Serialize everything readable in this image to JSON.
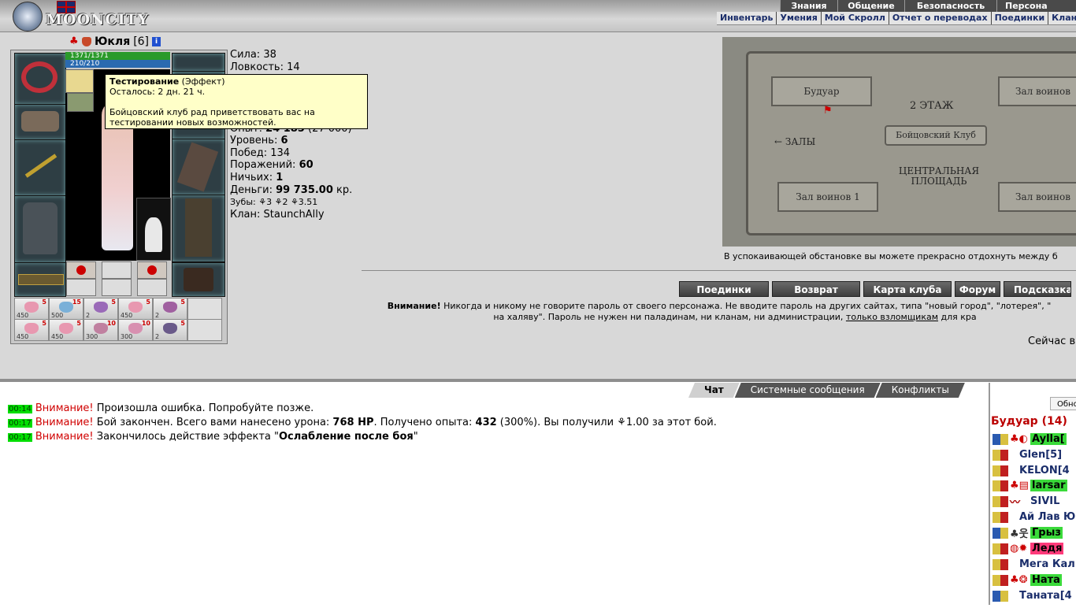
{
  "app": {
    "logo_text": "MOONCITY"
  },
  "main_menu": [
    "Знания",
    "Общение",
    "Безопасность",
    "Персона"
  ],
  "sub_menu": [
    "Инвентарь",
    "Умения",
    "Мой Скролл",
    "Отчет о переводах",
    "Поединки",
    "Клан"
  ],
  "character": {
    "name": "Юкля",
    "level": "[6]",
    "info_icon": "i",
    "hp": "1371/1371",
    "mp": "210/210"
  },
  "tooltip": {
    "title": "Тестирование",
    "type": "(Эффект)",
    "remaining": "Осталось: 2 дн. 21 ч.",
    "text": "Бойцовский клуб рад приветствовать вас на тестировании новых возможностей."
  },
  "stats": {
    "strength": "Сила: 38",
    "agility": "Ловкость: 14",
    "exp_label": "Опыт: ",
    "exp_value": "24 185",
    "exp_next": "(27 000)",
    "level_label": "Уровень: ",
    "level_value": "6",
    "wins": "Побед: 134",
    "losses_label": "Поражений: ",
    "losses_value": "60",
    "draws_label": "Ничьих: ",
    "draws_value": "1",
    "money_label": "Деньги: ",
    "money_value": "99 735.00",
    "money_unit": " кр.",
    "teeth": "Зубы: ⚘3 ⚘2 ⚘3.51",
    "clan": "Клан: StaunchAlly"
  },
  "inventory": {
    "row1": [
      {
        "count": "5",
        "sub": "450"
      },
      {
        "count": "15",
        "sub": "500"
      },
      {
        "count": "5",
        "sub": "2"
      },
      {
        "count": "5",
        "sub": "450"
      },
      {
        "count": "5",
        "sub": "2"
      }
    ],
    "row2": [
      {
        "count": "5",
        "sub": "450"
      },
      {
        "count": "5",
        "sub": "450"
      },
      {
        "count": "10",
        "sub": "300"
      },
      {
        "count": "10",
        "sub": "300"
      },
      {
        "count": "5",
        "sub": "2"
      }
    ]
  },
  "map": {
    "rooms": [
      "Будуар",
      "Зал воинов",
      "Зал воинов 1",
      "Зал воинов"
    ],
    "center_top": "2 ЭТАЖ",
    "center_mid": "Бойцовский Клуб",
    "center_bottom": "ЦЕНТРАЛЬНАЯ ПЛОЩАДЬ",
    "halls": "← ЗАЛЫ",
    "caption": "В успокаивающей обстановке вы можете прекрасно отдохнуть между б"
  },
  "nav_buttons": [
    "Поединки",
    "Возврат",
    "Карта клуба",
    "Форум",
    "Подсказка"
  ],
  "warning": {
    "bold": "Внимание!",
    "line1": " Никогда и никому не говорите пароль от своего персонажа. Не вводите пароль на других сайтах, типа \"новый город\", \"лотерея\", \"",
    "line2_a": "на халяву\". Пароль не нужен ни паладинам, ни кланам, ни администрации, ",
    "line2_link": "только взломщикам",
    "line2_b": " для кра"
  },
  "now_text": "Сейчас в",
  "chat": {
    "tabs": [
      "Чат",
      "Системные сообщения",
      "Конфликты"
    ],
    "lines": [
      {
        "time": "00:14",
        "warn": "Внимание!",
        "parts": [
          " Произошла ошибка. Попробуйте позже."
        ]
      },
      {
        "time": "00:17",
        "warn": "Внимание!",
        "pre": " Бой закончен. Всего вами нанесено урона: ",
        "b1": "768 HP",
        "mid": ". Получено опыта: ",
        "b2": "432",
        "post": " (300%). Вы получили ⚘1.00 за этот бой."
      },
      {
        "time": "00:17",
        "warn": "Внимание!",
        "pre": " Закончилось действие эффекта \"",
        "b1": "Ослабление после боя",
        "post": "\""
      }
    ]
  },
  "right_panel": {
    "refresh": "Обновить",
    "room_title": "Будуар (14)",
    "users": [
      {
        "name": "Aylla[",
        "hl": "green"
      },
      {
        "name": "Glen[5]",
        "hl": ""
      },
      {
        "name": "KELON[4",
        "hl": ""
      },
      {
        "name": "larsar",
        "hl": "green"
      },
      {
        "name": "SIVIL",
        "hl": ""
      },
      {
        "name": "Ай Лав Ю",
        "hl": ""
      },
      {
        "name": "Грыз",
        "hl": "green"
      },
      {
        "name": "Ледя",
        "hl": "red"
      },
      {
        "name": "Мега Кал",
        "hl": ""
      },
      {
        "name": "Ната",
        "hl": "green"
      },
      {
        "name": "Таната[4",
        "hl": ""
      }
    ]
  },
  "colors": {
    "time_badge": "#00dd00",
    "warning_red": "#d00000",
    "link_blue": "#1a2d6a",
    "menu_dark": "#4a4a4a"
  }
}
